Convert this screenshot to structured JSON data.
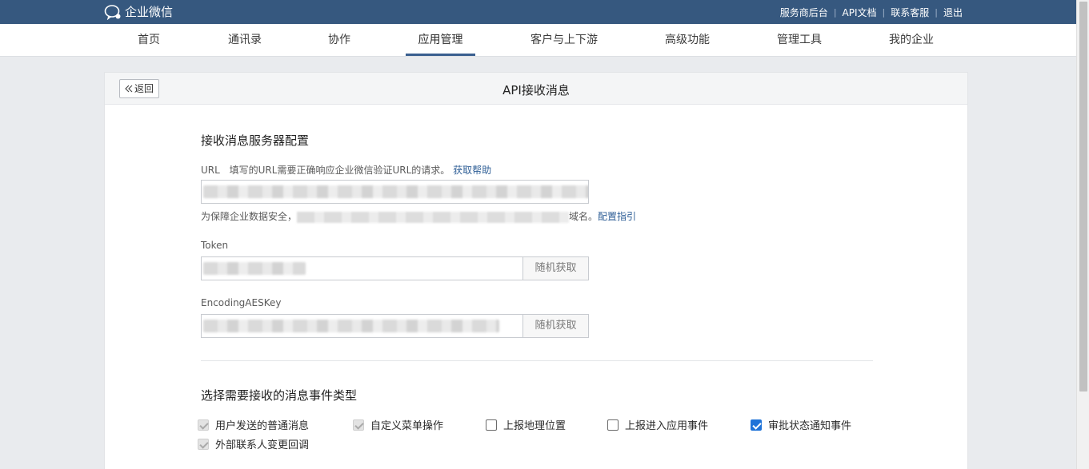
{
  "colors": {
    "topbar": "#36587f",
    "accent": "#3a5f8f",
    "link": "#2e5e96",
    "checkbox_checked": "#1f73d8"
  },
  "brand": {
    "name": "企业微信",
    "icon": "wechat-work-logo-icon"
  },
  "top_links": [
    "服务商后台",
    "API文档",
    "联系客服",
    "退出"
  ],
  "nav": {
    "items": [
      "首页",
      "通讯录",
      "协作",
      "应用管理",
      "客户与上下游",
      "高级功能",
      "管理工具",
      "我的企业"
    ],
    "active": "应用管理"
  },
  "page": {
    "back_label": "返回",
    "back_icon": "double-chevron-left-icon",
    "title": "API接收消息"
  },
  "server_config": {
    "section_title": "接收消息服务器配置",
    "url": {
      "label": "URL",
      "hint": "填写的URL需要正确响应企业微信验证URL的请求。",
      "help_link": "获取帮助"
    },
    "security_note": {
      "prefix": "为保障企业数据安全，",
      "suffix": "域名。",
      "link": "配置指引"
    },
    "token": {
      "label": "Token",
      "button": "随机获取"
    },
    "aes_key": {
      "label": "EncodingAESKey",
      "button": "随机获取"
    }
  },
  "events": {
    "section_title": "选择需要接收的消息事件类型",
    "options": [
      {
        "label": "用户发送的普通消息",
        "state": "checked-disabled"
      },
      {
        "label": "自定义菜单操作",
        "state": "checked-disabled"
      },
      {
        "label": "上报地理位置",
        "state": "unchecked"
      },
      {
        "label": "上报进入应用事件",
        "state": "unchecked"
      },
      {
        "label": "审批状态通知事件",
        "state": "checked"
      },
      {
        "label": "外部联系人变更回调",
        "state": "checked-disabled"
      }
    ]
  }
}
